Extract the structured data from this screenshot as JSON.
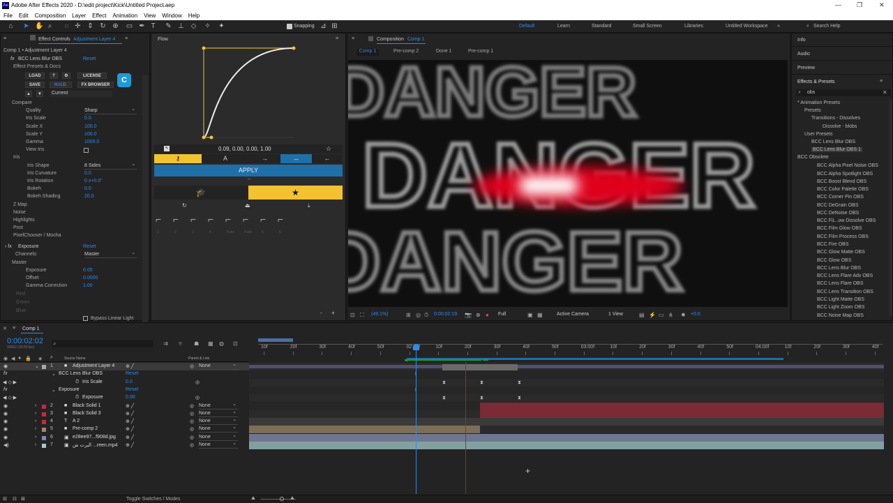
{
  "titlebar": {
    "title": "Adobe After Effects 2020 - D:\\edit project\\Kick\\Untitled Project.aep",
    "logo": "Ae"
  },
  "menu": [
    "File",
    "Edit",
    "Composition",
    "Layer",
    "Effect",
    "Animation",
    "View",
    "Window",
    "Help"
  ],
  "toolbar": {
    "snapping": "Snapping",
    "workspaces": [
      "Default",
      "Learn",
      "Standard",
      "Small Screen",
      "Libraries",
      "Untitled Workspace"
    ],
    "search": "Search Help"
  },
  "effect_controls": {
    "tab": "Effect Controls",
    "tab_layer": "Adjustment Layer 4",
    "subtitle": "Comp 1 • Adjustment Layer 4",
    "effect1": "BCC Lens Blur OBS",
    "reset": "Reset",
    "presets": "Effect Presets & Docs",
    "buttons": {
      "load": "LOAD",
      "q": "?",
      "license": "LICENSE",
      "save": "SAVE",
      "hud": "H.U.D.",
      "fxbrowser": "FX BROWSER",
      "current": "Current"
    },
    "params": [
      {
        "label": "Compare",
        "value": ""
      },
      {
        "label": "Quality",
        "value": "Sharp"
      },
      {
        "label": "Iris Scale",
        "value": "0.0"
      },
      {
        "label": "Scale X",
        "value": "100.0"
      },
      {
        "label": "Scale Y",
        "value": "100.0"
      },
      {
        "label": "Gamma",
        "value": "1000.0"
      },
      {
        "label": "View Iris",
        "value": ""
      },
      {
        "label": "Iris",
        "value": ""
      },
      {
        "label": "Iris Shape",
        "value": "8 Sides"
      },
      {
        "label": "Iris Curvature",
        "value": "0.0"
      },
      {
        "label": "Iris Rotation",
        "value": "0 x+0.0°"
      },
      {
        "label": "Bokeh",
        "value": "0.0"
      },
      {
        "label": "Bokeh Shading",
        "value": "20.0"
      },
      {
        "label": "Z Map",
        "value": ""
      },
      {
        "label": "Noise",
        "value": ""
      },
      {
        "label": "Highlights",
        "value": ""
      },
      {
        "label": "Post",
        "value": ""
      },
      {
        "label": "PixelChooser / Mocha",
        "value": ""
      }
    ],
    "effect2": "Exposure",
    "channels_label": "Channels:",
    "channels_value": "Master",
    "master": "Master",
    "exposure_params": [
      {
        "label": "Exposure",
        "value": "0.00"
      },
      {
        "label": "Offset",
        "value": "0.0000"
      },
      {
        "label": "Gamma Correction",
        "value": "1.00"
      }
    ],
    "dim": [
      "Red",
      "Green",
      "Blue"
    ],
    "bypass": "Bypass Linear Light"
  },
  "flow": {
    "tab": "Flow",
    "values": "0.09, 0.00, 0.00, 1.00",
    "apply": "APPLY",
    "labels": [
      "1",
      "2",
      "3",
      "4",
      "Fake",
      "Fake",
      "5",
      "6"
    ]
  },
  "composition": {
    "tab": "Composition",
    "tab_comp": "Comp 1",
    "breadcrumbs": [
      "Comp 1",
      "Pre-comp 2",
      "Done 1",
      "Pre-comp 1"
    ],
    "footer": {
      "zoom": "(49.1%)",
      "time": "0:00:02:19",
      "res": "Full",
      "camera": "Active Camera",
      "view": "1 View",
      "exposure": "+0.0"
    },
    "viewer_text": "DANGER"
  },
  "right_panel": {
    "tabs": [
      "Info",
      "Audio",
      "Preview"
    ],
    "effects_title": "Effects & Presets",
    "search": "obs",
    "tree": [
      "* Animation Presets",
      "Presets",
      "Transitions - Dissolves",
      "Dissolve - blobs",
      "User Presets",
      "BCC Lens Blur OBS",
      "BCC Lens Blur OBS 1",
      "BCC Obsolete"
    ],
    "obsolete": [
      "BCC Alpha Pixel Noise OBS",
      "BCC Alpha Spotlight OBS",
      "BCC Boost Blend OBS",
      "BCC Color Palette OBS",
      "BCC Corner Pin OBS",
      "BCC DeGrain OBS",
      "BCC DeNoise OBS",
      "BCC FiL..ow Dissolve OBS",
      "BCC Film Glow OBS",
      "BCC Film Process OBS",
      "BCC Fire OBS",
      "BCC Glow Matte OBS",
      "BCC Glow OBS",
      "BCC Lens Blur OBS",
      "BCC Lens Flare Adv OBS",
      "BCC Lens Flare OBS",
      "BCC Lens Transition OBS",
      "BCC Light Matte OBS",
      "BCC Light Zoom OBS",
      "BCC Noise Map OBS"
    ]
  },
  "timeline": {
    "tab": "Comp 1",
    "timecode": "0:00:02:02",
    "frames": "00062 (30.00 fps)",
    "headers": {
      "source": "Source Name",
      "parent": "Parent & Link"
    },
    "ruler": [
      "10f",
      "20f",
      "30f",
      "40f",
      "50f",
      "02:00f",
      "10f",
      "20f",
      "30f",
      "40f",
      "50f",
      "03:00f",
      "10f",
      "20f",
      "30f",
      "40f",
      "50f",
      "04:00f",
      "10f",
      "20f",
      "30f",
      "40f"
    ],
    "layers": [
      {
        "num": "1",
        "name": "Adjustment Layer 4",
        "parent": "None"
      },
      {
        "num": "",
        "name": "BCC Lens Blur OBS",
        "parent": "Reset"
      },
      {
        "num": "",
        "name": "Iris Scale",
        "parent": "0.0"
      },
      {
        "num": "",
        "name": "Exposure",
        "parent": "Reset"
      },
      {
        "num": "",
        "name": "Exposure",
        "parent": "0.00"
      },
      {
        "num": "2",
        "name": "Black Solid 1",
        "parent": "None"
      },
      {
        "num": "3",
        "name": "Black Solid 3",
        "parent": "None"
      },
      {
        "num": "4",
        "name": "A 2",
        "parent": "None"
      },
      {
        "num": "5",
        "name": "Pre-comp 2",
        "parent": "None"
      },
      {
        "num": "6",
        "name": "e28ee97...f908d.jpg",
        "parent": "None"
      },
      {
        "num": "7",
        "name": "اليرت ش ...reen.mp4",
        "parent": "None"
      }
    ],
    "footer": "Toggle Switches / Modes"
  },
  "colors": {
    "accent": "#2d8ceb",
    "yellow": "#f2c230",
    "red_bar": "#7a2b36",
    "panel": "#232323"
  }
}
